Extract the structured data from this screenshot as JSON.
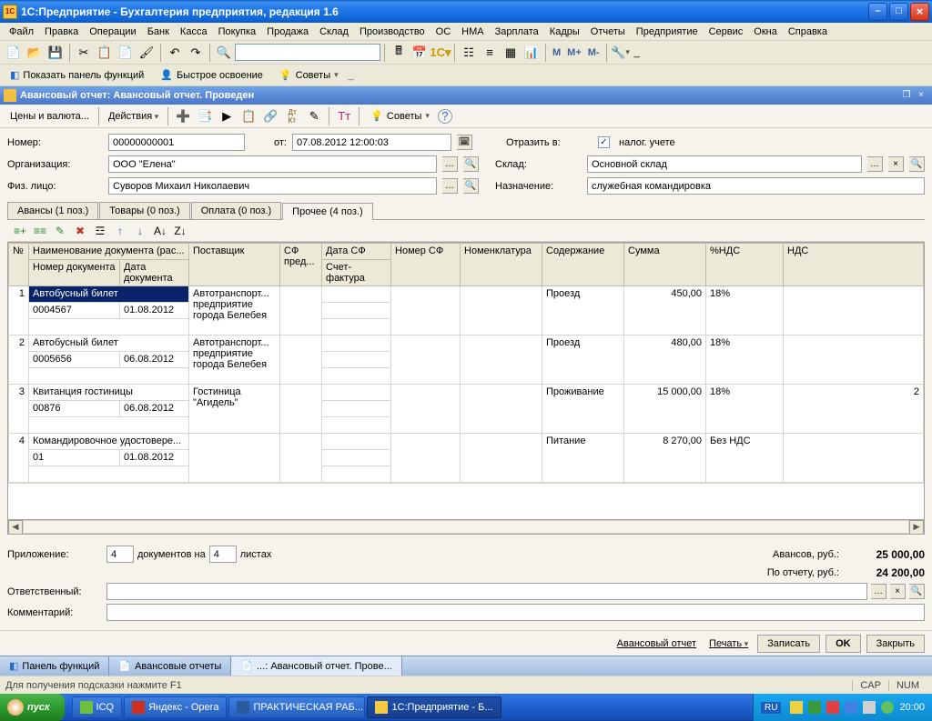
{
  "window": {
    "title": "1С:Предприятие - Бухгалтерия предприятия, редакция 1.6"
  },
  "mainMenu": [
    "Файл",
    "Правка",
    "Операции",
    "Банк",
    "Касса",
    "Покупка",
    "Продажа",
    "Склад",
    "Производство",
    "ОС",
    "НМА",
    "Зарплата",
    "Кадры",
    "Отчеты",
    "Предприятие",
    "Сервис",
    "Окна",
    "Справка"
  ],
  "secToolbar": {
    "showPanel": "Показать панель функций",
    "quickLearn": "Быстрое освоение",
    "tips": "Советы"
  },
  "doc": {
    "title": "Авансовый отчет: Авансовый отчет. Проведен",
    "pricesAndCurrency": "Цены и валюта...",
    "actions": "Действия",
    "tips": "Советы",
    "numberLabel": "Номер:",
    "number": "00000000001",
    "fromLabel": "от:",
    "date": "07.08.2012 12:00:03",
    "reflectIn": "Отразить в:",
    "taxAccounting": "налог. учете",
    "orgLabel": "Организация:",
    "org": "ООО \"Елена\"",
    "warehouseLabel": "Склад:",
    "warehouse": "Основной склад",
    "personLabel": "Физ. лицо:",
    "person": "Суворов Михаил Николаевич",
    "purposeLabel": "Назначение:",
    "purpose": "служебная командировка"
  },
  "tabs": [
    "Авансы (1 поз.)",
    "Товары (0 поз.)",
    "Оплата (0 поз.)",
    "Прочее (4 поз.)"
  ],
  "grid": {
    "headers": {
      "num": "№",
      "docName": "Наименование документа (рас...",
      "docNum": "Номер документа",
      "docDate": "Дата документа",
      "supplier": "Поставщик",
      "sfPresented": "СФ пред...",
      "sfDate": "Дата СФ",
      "invoice": "Счет-фактура",
      "sfNumber": "Номер СФ",
      "nomenclature": "Номенклатура",
      "content": "Содержание",
      "sum": "Сумма",
      "vatRate": "%НДС",
      "vat": "НДС"
    },
    "rows": [
      {
        "n": "1",
        "docName": "Автобусный   билет",
        "docNum": "0004567",
        "docDate": "01.08.2012",
        "supplier": "Автотранспорт... предприятие города Белебея",
        "content": "Проезд",
        "sum": "450,00",
        "vatRate": "18%",
        "vat": ""
      },
      {
        "n": "2",
        "docName": "Автобусный билет",
        "docNum": "0005656",
        "docDate": "06.08.2012",
        "supplier": "Автотранспорт... предприятие города Белебея",
        "content": "Проезд",
        "sum": "480,00",
        "vatRate": "18%",
        "vat": ""
      },
      {
        "n": "3",
        "docName": "Квитанция гостиницы",
        "docNum": "00876",
        "docDate": "06.08.2012",
        "supplier": "Гостиница \"Агидель\"",
        "content": "Проживание",
        "sum": "15 000,00",
        "vatRate": "18%",
        "vat": "2"
      },
      {
        "n": "4",
        "docName": "Командировочное удостовере...",
        "docNum": "01",
        "docDate": "01.08.2012",
        "supplier": "",
        "content": "Питание",
        "sum": "8 270,00",
        "vatRate": "Без НДС",
        "vat": ""
      }
    ]
  },
  "bottom": {
    "attachLabel": "Приложение:",
    "attachCount": "4",
    "docsOn": "документов на",
    "sheetsCount": "4",
    "sheets": "листах",
    "advancesLabel": "Авансов, руб.:",
    "advancesValue": "25 000,00",
    "reportLabel": "По отчету, руб.:",
    "reportValue": "24 200,00",
    "responsibleLabel": "Ответственный:",
    "commentLabel": "Комментарий:"
  },
  "cmdBar": {
    "report": "Авансовый отчет",
    "print": "Печать",
    "save": "Записать",
    "ok": "OK",
    "close": "Закрыть"
  },
  "panelTabs": [
    "Панель функций",
    "Авансовые отчеты",
    "...: Авансовый отчет. Прове..."
  ],
  "statusBar": {
    "hint": "Для получения подсказки нажмите F1",
    "cap": "CAP",
    "num": "NUM"
  },
  "taskbar": {
    "start": "пуск",
    "tasks": [
      "ICQ",
      "Яндекс - Opera",
      "ПРАКТИЧЕСКАЯ РАБ...",
      "1С:Предприятие - Б..."
    ],
    "lang": "RU",
    "time": "20:00"
  }
}
